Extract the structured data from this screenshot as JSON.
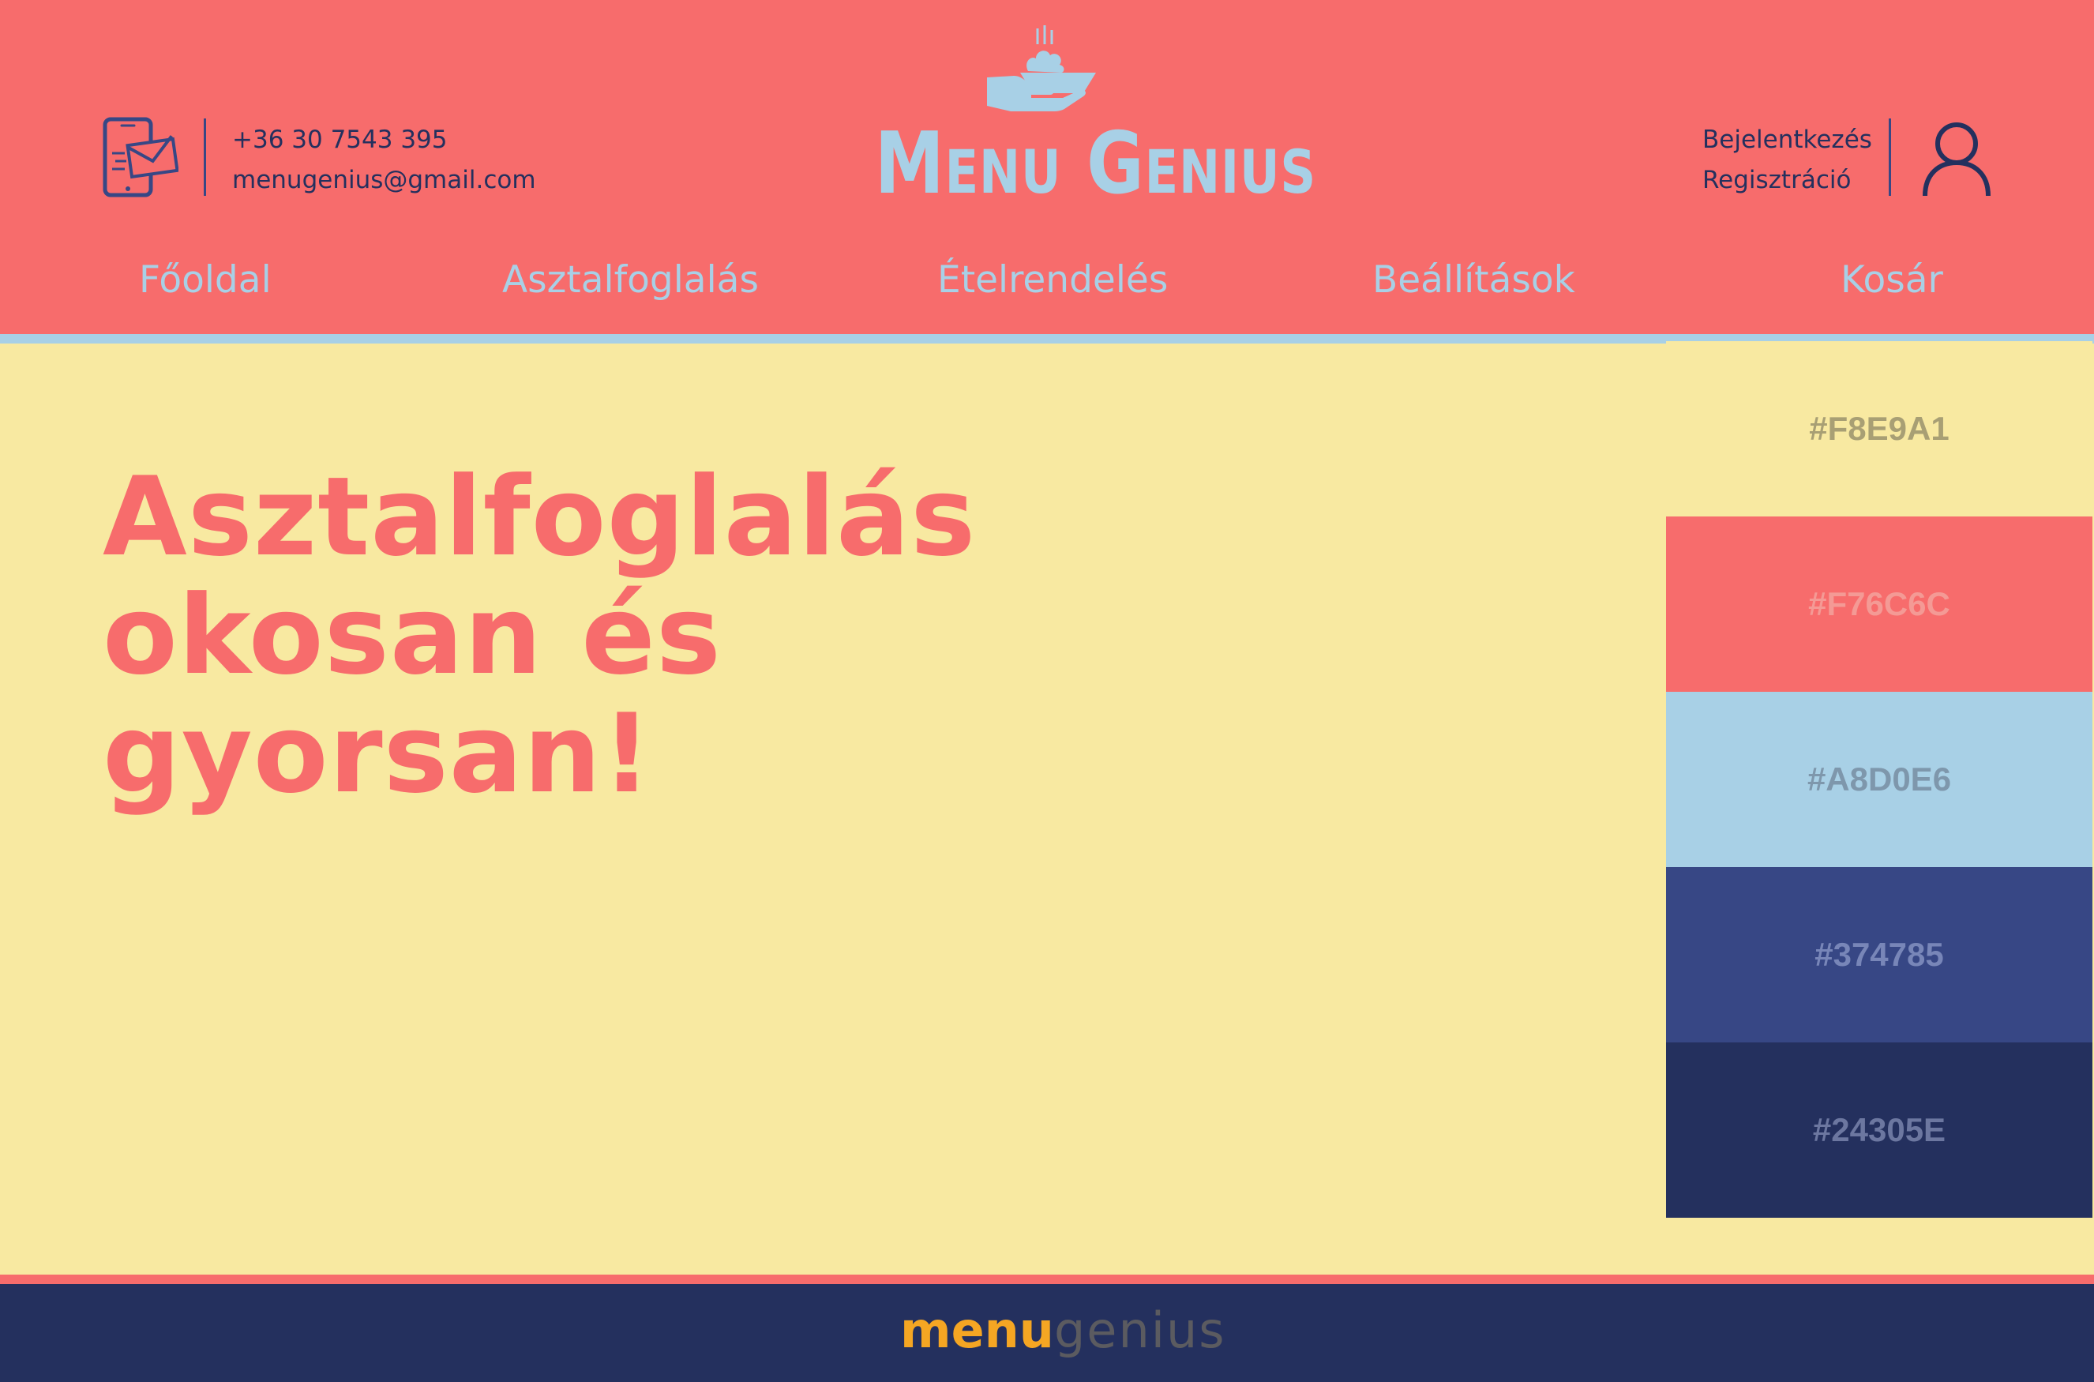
{
  "header": {
    "contact": {
      "icon": "phone-mail-icon",
      "phone": "+36 30 7543 395",
      "email": "menugenius@gmail.com"
    },
    "brand": {
      "icon": "serving-hand-icon",
      "name": "Menu Genius"
    },
    "auth": {
      "login": "Bejelentkezés",
      "register": "Regisztráció",
      "icon": "user-icon"
    }
  },
  "nav": {
    "items": [
      {
        "label": "Főoldal"
      },
      {
        "label": "Asztalfoglalás"
      },
      {
        "label": "Ételrendelés"
      },
      {
        "label": "Beállítások"
      },
      {
        "label": "Kosár"
      }
    ]
  },
  "hero": {
    "lines": [
      "Asztalfoglalás",
      "okosan és",
      "gyorsan!"
    ]
  },
  "palette": {
    "swatches": [
      {
        "label": "#F8E9A1",
        "color": "#F8E9A1",
        "text_color": "#A89F74"
      },
      {
        "label": "#F76C6C",
        "color": "#F76C6C",
        "text_color": "#F49A95"
      },
      {
        "label": "#A8D0E6",
        "color": "#A8D0E6",
        "text_color": "#7E97AC"
      },
      {
        "label": "#374785",
        "color": "#374785",
        "text_color": "#7886B8"
      },
      {
        "label": "#24305E",
        "color": "#24305E",
        "text_color": "#6C77A0"
      }
    ]
  },
  "footer": {
    "logo_part1": "menu",
    "logo_part2": "genius"
  },
  "colors": {
    "background": "#F8E9A1",
    "accent": "#F76C6C",
    "light_blue": "#A8D0E6",
    "blue": "#374785",
    "navy": "#24305E",
    "footer_logo_orange": "#F5A623"
  }
}
